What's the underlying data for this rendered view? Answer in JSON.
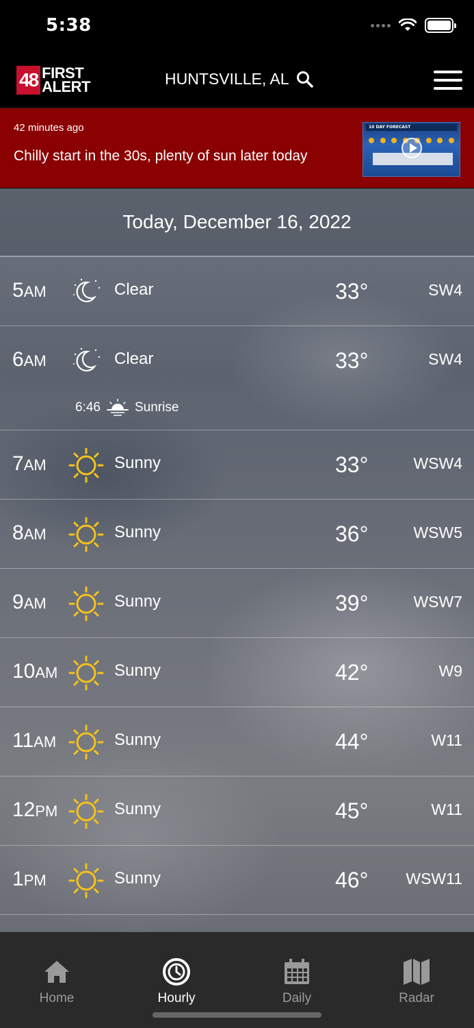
{
  "status_bar": {
    "time": "5:38"
  },
  "header": {
    "logo_number": "48",
    "logo_line1": "FIRST",
    "logo_line2": "ALERT",
    "location": "HUNTSVILLE, AL"
  },
  "alert": {
    "time_ago": "42 minutes ago",
    "headline": "Chilly start in the 30s, plenty of sun later today",
    "thumbnail_label": "10 DAY FORECAST"
  },
  "main": {
    "date": "Today, December 16, 2022",
    "hours": [
      {
        "hour": "5",
        "ampm": "AM",
        "icon": "moon-icon",
        "condition": "Clear",
        "temp": "33°",
        "wind": "SW4"
      },
      {
        "hour": "6",
        "ampm": "AM",
        "icon": "moon-icon",
        "condition": "Clear",
        "temp": "33°",
        "wind": "SW4",
        "event_time": "6:46",
        "event_label": "Sunrise"
      },
      {
        "hour": "7",
        "ampm": "AM",
        "icon": "sun-icon",
        "condition": "Sunny",
        "temp": "33°",
        "wind": "WSW4"
      },
      {
        "hour": "8",
        "ampm": "AM",
        "icon": "sun-icon",
        "condition": "Sunny",
        "temp": "36°",
        "wind": "WSW5"
      },
      {
        "hour": "9",
        "ampm": "AM",
        "icon": "sun-icon",
        "condition": "Sunny",
        "temp": "39°",
        "wind": "WSW7"
      },
      {
        "hour": "10",
        "ampm": "AM",
        "icon": "sun-icon",
        "condition": "Sunny",
        "temp": "42°",
        "wind": "W9"
      },
      {
        "hour": "11",
        "ampm": "AM",
        "icon": "sun-icon",
        "condition": "Sunny",
        "temp": "44°",
        "wind": "W11"
      },
      {
        "hour": "12",
        "ampm": "PM",
        "icon": "sun-icon",
        "condition": "Sunny",
        "temp": "45°",
        "wind": "W11"
      },
      {
        "hour": "1",
        "ampm": "PM",
        "icon": "sun-icon",
        "condition": "Sunny",
        "temp": "46°",
        "wind": "WSW11"
      }
    ]
  },
  "tabs": [
    {
      "label": "Home",
      "icon": "home-icon",
      "active": false
    },
    {
      "label": "Hourly",
      "icon": "clock-icon",
      "active": true
    },
    {
      "label": "Daily",
      "icon": "calendar-icon",
      "active": false
    },
    {
      "label": "Radar",
      "icon": "map-icon",
      "active": false
    }
  ],
  "colors": {
    "alert_background": "#8b0000",
    "sun": "#f6c21b",
    "tab_bar": "#2a2a2a"
  }
}
